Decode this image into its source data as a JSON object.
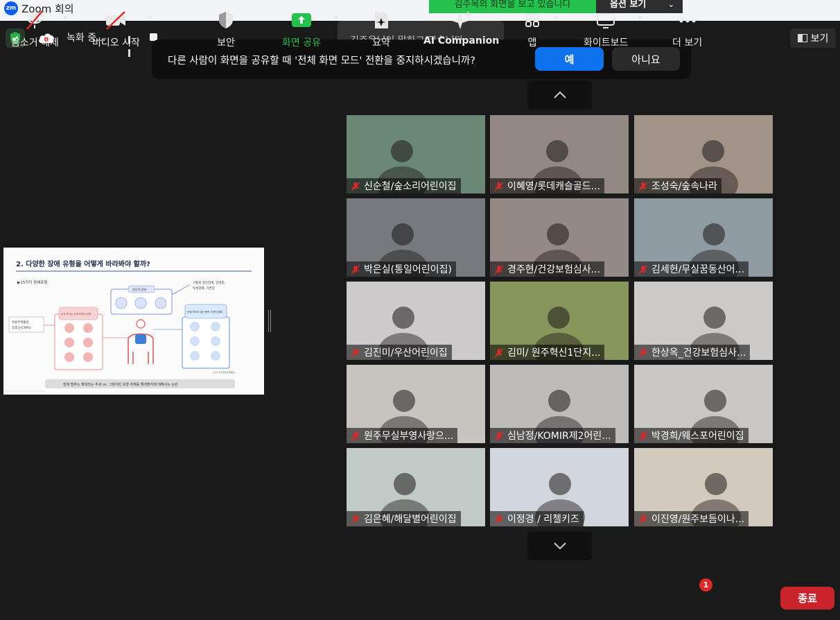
{
  "app": {
    "title": "Zoom 회의",
    "logo_text": "zm"
  },
  "share_banner": {
    "text": "김주옥의 화면을 보고 있습니다",
    "options_label": "옵션 보기"
  },
  "recording": {
    "status": "녹화 중..."
  },
  "view_button": {
    "label": "보기"
  },
  "speaking_toast": {
    "text": "김주옥님이 말하고 있습니다..."
  },
  "dialog": {
    "message": "다른 사람이 화면을 공유할 때 '전체 화면 모드' 전환을 중지하시겠습니까?",
    "yes_label": "예",
    "no_label": "아니요"
  },
  "slide": {
    "title": "2. 다양한 장애 유형을 어떻게 바라봐야 할까?",
    "subtitle": "▶15가지 장애유형",
    "left_note_1": "복합부위통증",
    "left_note_2": "증후군(CRPS)",
    "center_box_label": "정신적 장애",
    "right_note_1": "기질성 정신장애, 강박증,",
    "right_note_2": "투렛장애, 기면증",
    "left_box_label": "눈에 보이는 신체 부위의 장애",
    "right_box_label": "눈에 보이지 않는 몸속 기관의 장애",
    "footer_source": "(출처: 한국장애인개발원)",
    "bottom_bar": "장애 범주는 확대되는 추세 vs. 그렇지만 유형 자체를 확대할지에 대해서는 논란"
  },
  "participants": [
    {
      "name": "신순철/숲소리어린이집",
      "bg": "#5f7d6b"
    },
    {
      "name": "이혜영/롯데캐슬골드...",
      "bg": "#8a7f78"
    },
    {
      "name": "조성숙/숲속나라",
      "bg": "#9a8a7e"
    },
    {
      "name": "박은실(통일어린이집)",
      "bg": "#6b6f74"
    },
    {
      "name": "경주현/건강보험심사...",
      "bg": "#8b7f7a"
    },
    {
      "name": "김세헌/무실꿈동산어...",
      "bg": "#86939b"
    },
    {
      "name": "김진미/우산어린이집",
      "bg": "#c9c7c8"
    },
    {
      "name": "김미/ 원주혁신1단지...",
      "bg": "#7d8e4d"
    },
    {
      "name": "한상옥_건강보험심사...",
      "bg": "#c8c6c5"
    },
    {
      "name": "원주무실부영사랑으...",
      "bg": "#c4c1bc"
    },
    {
      "name": "심남정/KOMIR제2어린...",
      "bg": "#b9b7b5"
    },
    {
      "name": "박경희/웨스포어린이집",
      "bg": "#c5c3c1"
    },
    {
      "name": "김은혜/해달별어린이집",
      "bg": "#bcc6c2"
    },
    {
      "name": "이정경 / 리첼키즈",
      "bg": "#cdd3da"
    },
    {
      "name": "이진영/원주보듬이나...",
      "bg": "#cfc6b8"
    }
  ],
  "toolbar": {
    "mute": "음소거 해제",
    "video": "비디오 시작",
    "security": "보안",
    "share": "화면 공유",
    "summary": "요약",
    "ai": "AI Companion",
    "apps": "앱",
    "whiteboard": "화이트보드",
    "more": "더 보기",
    "more_badge": "1",
    "end": "종료"
  },
  "colors": {
    "accent": "#0e72ed",
    "share_green": "#23c14d",
    "end_red": "#c9232b",
    "muted_red": "#e02828"
  }
}
